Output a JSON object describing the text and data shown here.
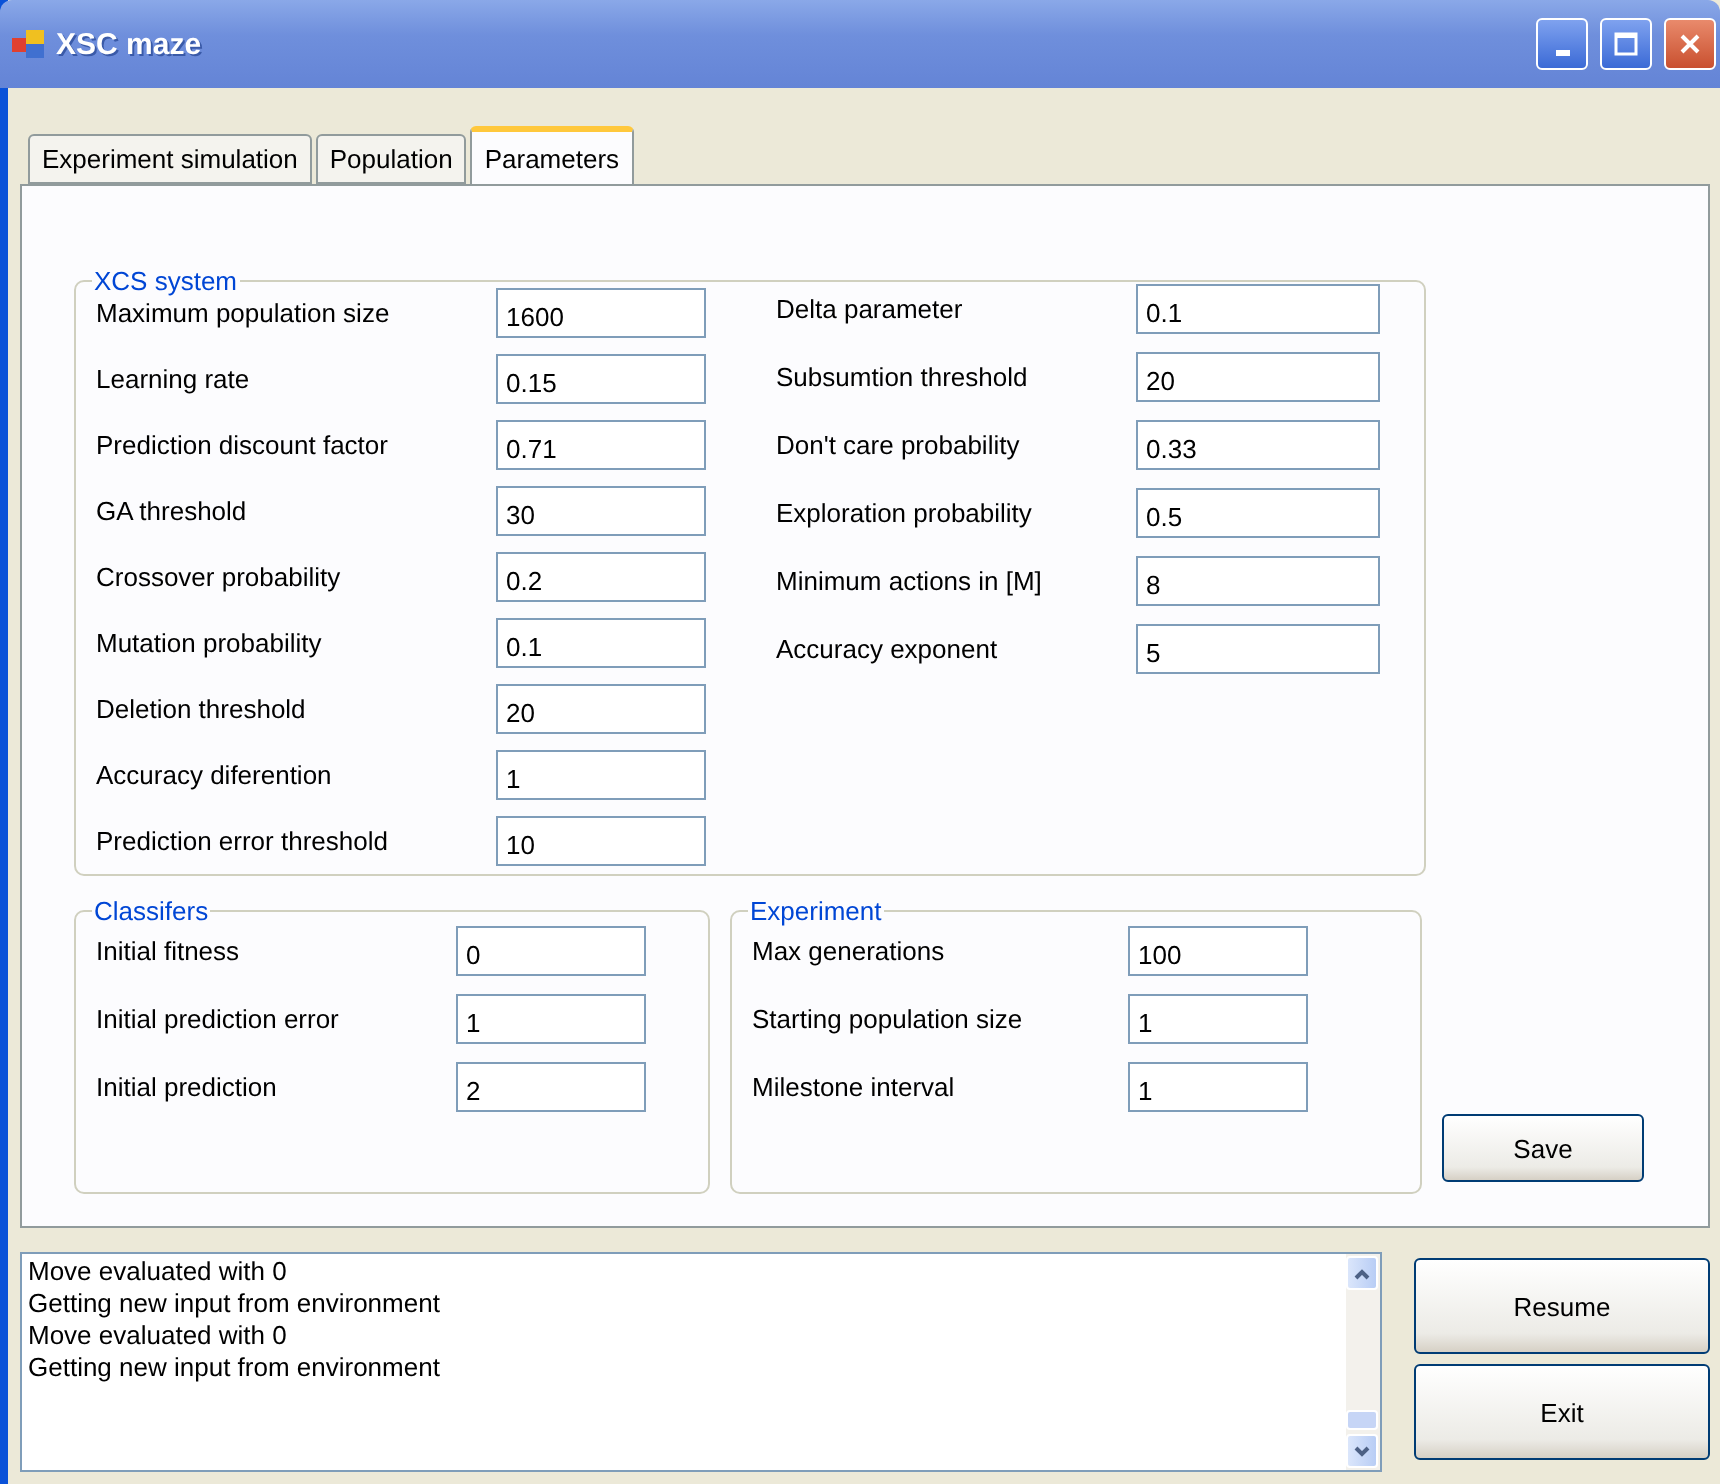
{
  "window": {
    "title": "XSC maze"
  },
  "tabs": [
    {
      "label": "Experiment simulation",
      "selected": false
    },
    {
      "label": "Population",
      "selected": false
    },
    {
      "label": "Parameters",
      "selected": true
    }
  ],
  "xcs_system": {
    "title": "XCS system",
    "left_params": [
      {
        "label": "Maximum population size",
        "value": "1600"
      },
      {
        "label": "Learning rate",
        "value": "0.15"
      },
      {
        "label": "Prediction discount factor",
        "value": "0.71"
      },
      {
        "label": "GA threshold",
        "value": "30"
      },
      {
        "label": "Crossover probability",
        "value": "0.2"
      },
      {
        "label": "Mutation probability",
        "value": "0.1"
      },
      {
        "label": "Deletion threshold",
        "value": "20"
      },
      {
        "label": "Accuracy diferention",
        "value": "1"
      },
      {
        "label": "Prediction error threshold",
        "value": "10"
      }
    ],
    "right_params": [
      {
        "label": "Delta parameter",
        "value": "0.1"
      },
      {
        "label": "Subsumtion threshold",
        "value": "20"
      },
      {
        "label": "Don't care probability",
        "value": "0.33"
      },
      {
        "label": "Exploration probability",
        "value": "0.5"
      },
      {
        "label": "Minimum actions in [M]",
        "value": "8"
      },
      {
        "label": "Accuracy exponent",
        "value": "5"
      }
    ]
  },
  "classifiers": {
    "title": "Classifers",
    "params": [
      {
        "label": "Initial fitness",
        "value": "0"
      },
      {
        "label": "Initial prediction error",
        "value": "1"
      },
      {
        "label": "Initial prediction",
        "value": "2"
      }
    ]
  },
  "experiment": {
    "title": "Experiment",
    "params": [
      {
        "label": "Max generations",
        "value": "100"
      },
      {
        "label": "Starting population size",
        "value": "1"
      },
      {
        "label": "Milestone interval",
        "value": "1"
      }
    ]
  },
  "save_button": "Save",
  "log": {
    "lines": [
      "Move evaluated with 0",
      "Getting new input from environment",
      "Move evaluated with 0",
      "Getting new input from environment"
    ]
  },
  "buttons": [
    "Resume",
    "Exit"
  ]
}
